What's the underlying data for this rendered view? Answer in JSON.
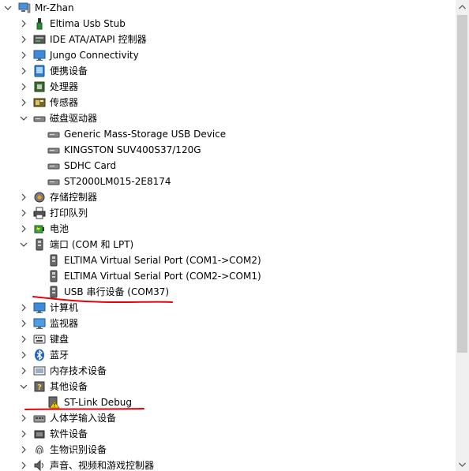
{
  "tree": {
    "root": {
      "label": "Mr-Zhan"
    },
    "items": [
      {
        "label": "Eltima Usb Stub",
        "icon": "usb-icon"
      },
      {
        "label": "IDE ATA/ATAPI 控制器",
        "icon": "ide-controller-icon"
      },
      {
        "label": "Jungo Connectivity",
        "icon": "monitor-icon"
      },
      {
        "label": "便携设备",
        "icon": "portable-device-icon"
      },
      {
        "label": "处理器",
        "icon": "processor-icon"
      },
      {
        "label": "传感器",
        "icon": "sensor-icon"
      },
      {
        "label": "磁盘驱动器",
        "icon": "disk-drive-icon"
      },
      {
        "label": "Generic Mass-Storage USB Device",
        "icon": "disk-drive-icon"
      },
      {
        "label": "KINGSTON SUV400S37/120G",
        "icon": "disk-drive-icon"
      },
      {
        "label": "SDHC Card",
        "icon": "disk-drive-icon"
      },
      {
        "label": "ST2000LM015-2E8174",
        "icon": "disk-drive-icon"
      },
      {
        "label": "存储控制器",
        "icon": "storage-controller-icon"
      },
      {
        "label": "打印队列",
        "icon": "printer-icon"
      },
      {
        "label": "电池",
        "icon": "battery-icon"
      },
      {
        "label": "端口 (COM 和 LPT)",
        "icon": "port-icon"
      },
      {
        "label": "ELTIMA Virtual Serial Port (COM1->COM2)",
        "icon": "port-icon"
      },
      {
        "label": "ELTIMA Virtual Serial Port (COM2->COM1)",
        "icon": "port-icon"
      },
      {
        "label": "USB 串行设备 (COM37)",
        "icon": "port-icon"
      },
      {
        "label": "计算机",
        "icon": "computer-icon"
      },
      {
        "label": "监视器",
        "icon": "monitor-icon"
      },
      {
        "label": "键盘",
        "icon": "keyboard-icon"
      },
      {
        "label": "蓝牙",
        "icon": "bluetooth-icon"
      },
      {
        "label": "内存技术设备",
        "icon": "memory-device-icon"
      },
      {
        "label": "其他设备",
        "icon": "unknown-device-icon"
      },
      {
        "label": "ST-Link Debug",
        "icon": "warning-device-icon"
      },
      {
        "label": "人体学输入设备",
        "icon": "hid-icon"
      },
      {
        "label": "软件设备",
        "icon": "software-device-icon"
      },
      {
        "label": "生物识别设备",
        "icon": "fingerprint-icon"
      },
      {
        "label": "声音、视频和游戏控制器",
        "icon": "sound-icon"
      }
    ]
  },
  "annotations": {
    "underline_color": "#e8000b"
  },
  "colors": {
    "scrollbar_track": "#f0f0f0",
    "scrollbar_thumb": "#cdcdcd",
    "chevron": "#404040"
  }
}
